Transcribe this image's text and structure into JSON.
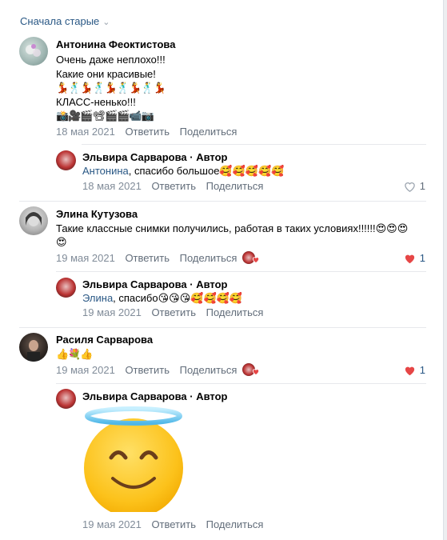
{
  "sort": {
    "label": "Сначала старые"
  },
  "comments": [
    {
      "author": "Антонина Феоктистова",
      "lines": [
        "Очень даже неплохо!!!",
        "Какие они красивые!",
        "💃🕺💃🕺💃🕺💃🕺💃",
        "КЛАСС-ненько!!!",
        "📸🎥🎬📽🎬🎬📹📷"
      ],
      "date": "18 мая 2021",
      "reply": "Ответить",
      "share": "Поделиться",
      "reply_item": {
        "author": "Эльвира Сарварова · Автор",
        "to": "Антонина",
        "text": ", спасибо большое🥰🥰🥰🥰🥰",
        "date": "18 мая 2021",
        "reply": "Ответить",
        "share": "Поделиться",
        "likes": "1"
      }
    },
    {
      "author": "Элина Кутузова",
      "lines": [
        "Такие классные снимки получились, работая в таких условиях!!!!!!😍😍😍",
        "😍"
      ],
      "date": "19 мая 2021",
      "reply": "Ответить",
      "share": "Поделиться",
      "likes": "1",
      "reply_item": {
        "author": "Эльвира Сарварова · Автор",
        "to": "Элина",
        "text": ", спасибо😘😘😘🥰🥰🥰🥰",
        "date": "19 мая 2021",
        "reply": "Ответить",
        "share": "Поделиться"
      }
    },
    {
      "author": "Расиля Сарварова",
      "lines": [
        "👍💐👍"
      ],
      "date": "19 мая 2021",
      "reply": "Ответить",
      "share": "Поделиться",
      "likes": "1",
      "reply_item": {
        "author": "Эльвира Сарварова · Автор",
        "date": "19 мая 2021",
        "reply": "Ответить",
        "share": "Поделиться",
        "sticker": "smiling-face-with-halo"
      }
    }
  ],
  "colors": {
    "link": "#2a5885",
    "meta": "#818c99",
    "like_red": "#e64646"
  }
}
